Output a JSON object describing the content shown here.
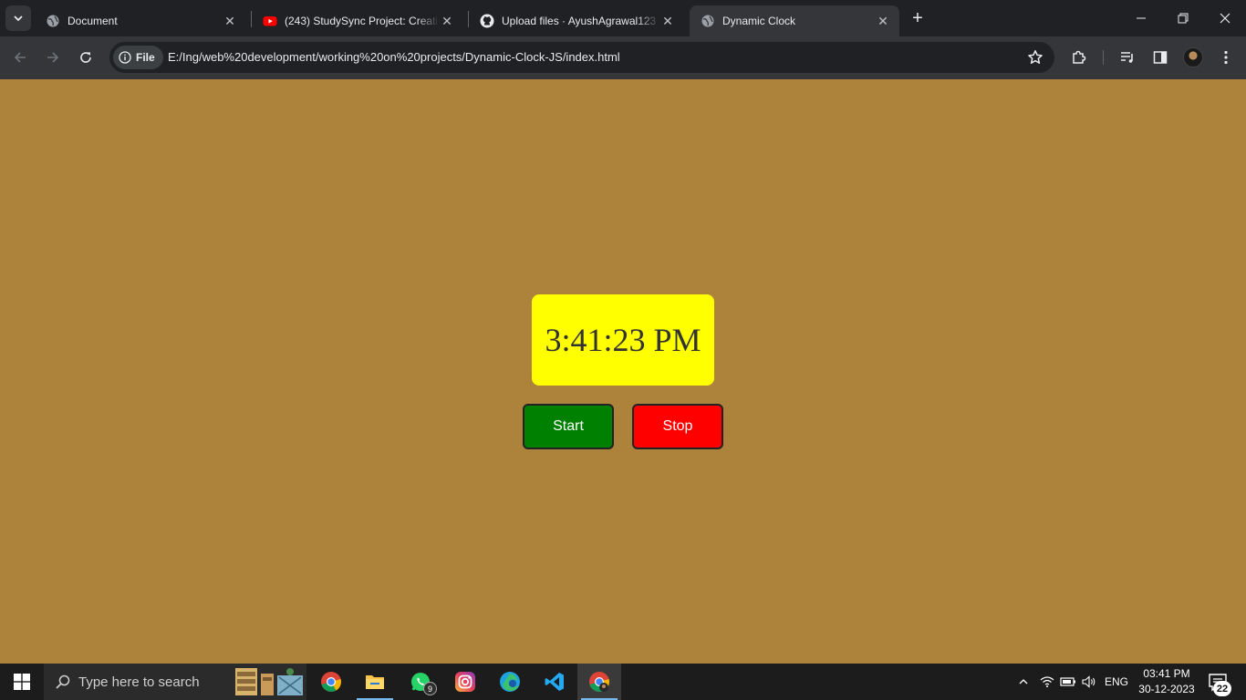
{
  "browser": {
    "tabs": [
      {
        "title": "Document",
        "favicon": "globe-icon"
      },
      {
        "title": "(243) StudySync Project: Creatin",
        "favicon": "youtube-icon"
      },
      {
        "title": "Upload files · AyushAgrawal123",
        "favicon": "github-icon"
      },
      {
        "title": "Dynamic Clock",
        "favicon": "globe-icon",
        "active": true
      }
    ],
    "site_info_label": "File",
    "url": "E:/Ing/web%20development/working%20on%20projects/Dynamic-Clock-JS/index.html"
  },
  "page": {
    "clock_text": "3:41:23 PM",
    "start_label": "Start",
    "stop_label": "Stop",
    "colors": {
      "background": "#ad823a",
      "clock_bg": "#ffff00",
      "start_bg": "#008000",
      "stop_bg": "#ff0000"
    }
  },
  "taskbar": {
    "search_placeholder": "Type here to search",
    "apps": [
      "chrome-icon",
      "file-explorer-icon",
      "whatsapp-icon",
      "instagram-icon",
      "edge-icon",
      "vscode-icon",
      "chrome-profile-icon"
    ],
    "whatsapp_badge": "9",
    "language": "ENG",
    "time": "03:41 PM",
    "date": "30-12-2023",
    "notification_count": "22"
  }
}
